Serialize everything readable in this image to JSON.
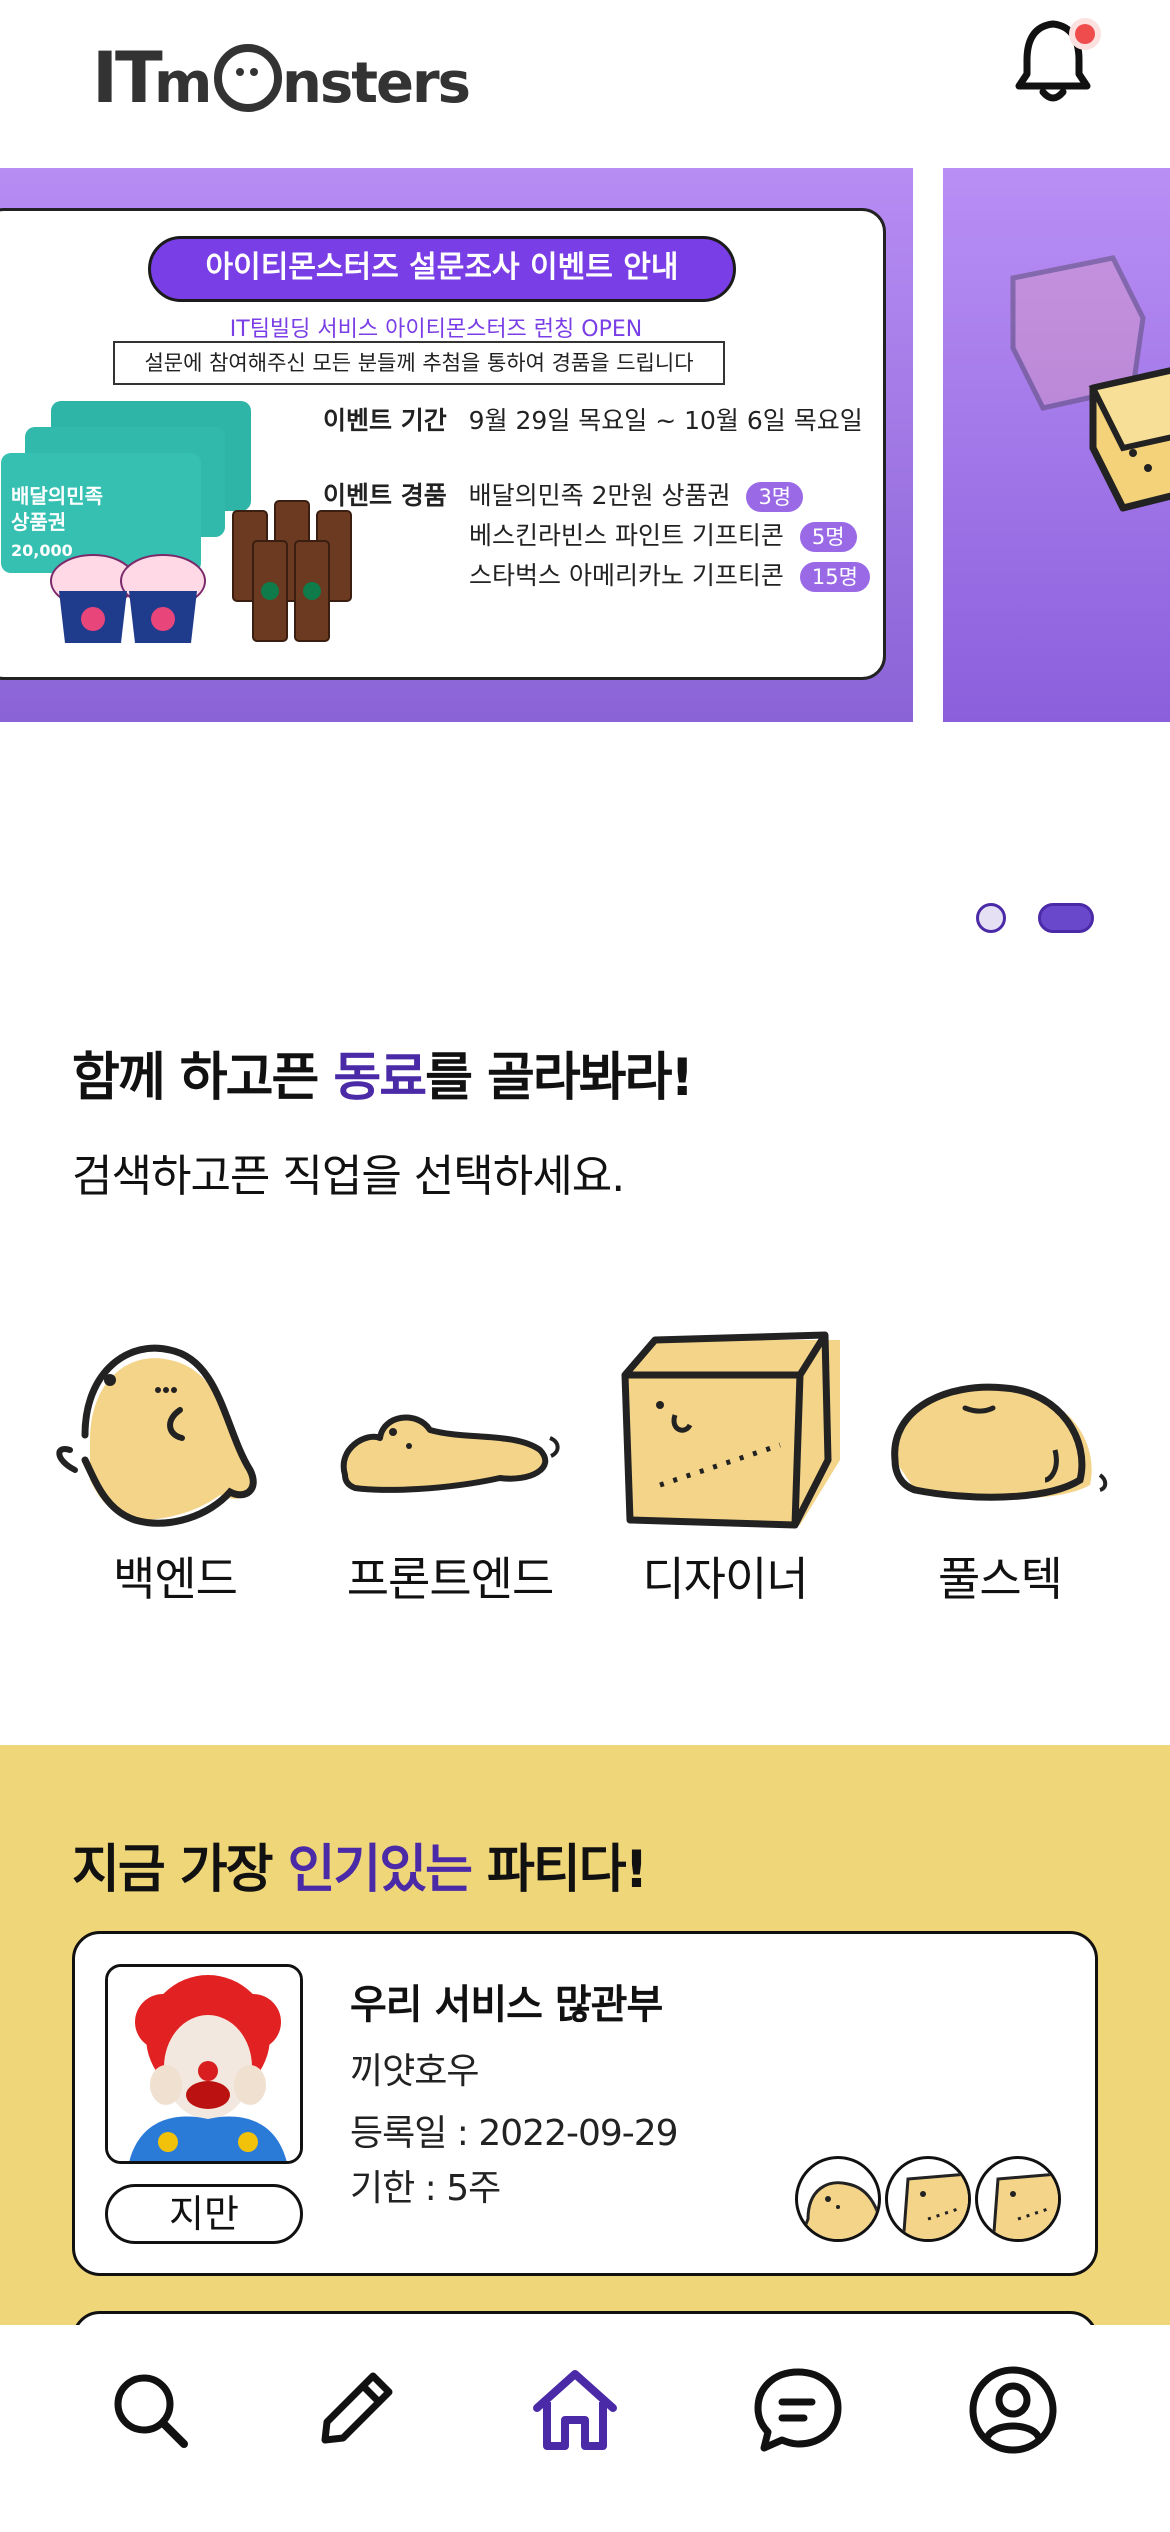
{
  "header": {
    "logo_text": "ITmOnsters",
    "notification_dot_color": "#ef4d4d"
  },
  "banner": {
    "title": "아이티몬스터즈 설문조사 이벤트 안내",
    "subtitle": "IT팀빌딩 서비스 아이티몬스터즈 런칭 OPEN",
    "notice": "설문에 참여해주신 모든 분들께 추첨을 통하여 경품을 드립니다",
    "period_label": "이벤트 기간",
    "period_value": "9월 29일 목요일 ~ 10월 6일 목요일",
    "prize_label": "이벤트 경품",
    "prizes": [
      {
        "name": "배달의민족 2만원 상품권",
        "count": "3명"
      },
      {
        "name": "베스킨라빈스 파인트 기프티콘",
        "count": "5명"
      },
      {
        "name": "스타벅스 아메리카노 기프티콘",
        "count": "15명"
      }
    ],
    "gift_card_text": "배달의민족",
    "gift_card_sub": "상품권",
    "gift_card_amount": "20,000"
  },
  "pager": {
    "total": 2,
    "active": 2
  },
  "jobs_section": {
    "title_pre": "함께 하고픈 ",
    "title_accent": "동료",
    "title_post": "를 골라봐라!",
    "subtitle": "검색하고픈 직업을 선택하세요.",
    "jobs": [
      {
        "label": "백엔드"
      },
      {
        "label": "프론트엔드"
      },
      {
        "label": "디자이너"
      },
      {
        "label": "풀스텍"
      }
    ]
  },
  "popular_section": {
    "title_pre": "지금 가장 ",
    "title_accent": "인기있는",
    "title_post": " 파티다!",
    "party": {
      "title": "우리 서비스 많관부",
      "author": "끼얏호우",
      "registered": "등록일 : 2022-09-29",
      "deadline": "기한 : 5주",
      "nickname": "지만",
      "member_count": 3
    }
  },
  "bottom_nav": {
    "items": [
      "search-icon",
      "pencil-icon",
      "home-icon",
      "chat-icon",
      "profile-icon"
    ],
    "active_color": "#4b2aa8"
  },
  "colors": {
    "accent": "#4b2aa8",
    "yellow": "#efd678",
    "banner_purple": "#7a3ee6"
  }
}
